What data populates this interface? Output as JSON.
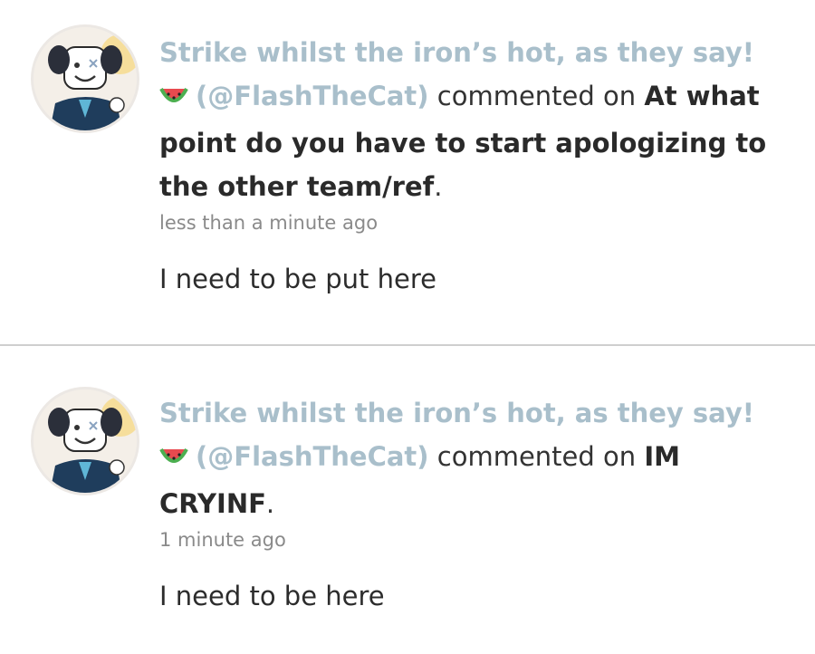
{
  "notifications": [
    {
      "user_name": "Strike whilst the iron’s hot, as they say!",
      "handle": "(@FlashTheCat)",
      "action": "commented on",
      "post_title": "At what point do you have to start apologizing to the other team/ref",
      "period": ".",
      "timestamp": "less than a minute ago",
      "comment": "I need to be put here",
      "avatar_icon": "cartoon-avatar-icon",
      "emoji_icon": "watermelon-icon"
    },
    {
      "user_name": "Strike whilst the iron’s hot, as they say!",
      "handle": "(@FlashTheCat)",
      "action": "commented on",
      "post_title": "IM CRYINF",
      "period": ".",
      "timestamp": "1 minute ago",
      "comment": "I need to be here",
      "avatar_icon": "cartoon-avatar-icon",
      "emoji_icon": "watermelon-icon"
    }
  ],
  "colors": {
    "username": "#a9bfcb",
    "text": "#333333",
    "timestamp": "#8a8a8a",
    "divider": "#cfcfcf"
  }
}
